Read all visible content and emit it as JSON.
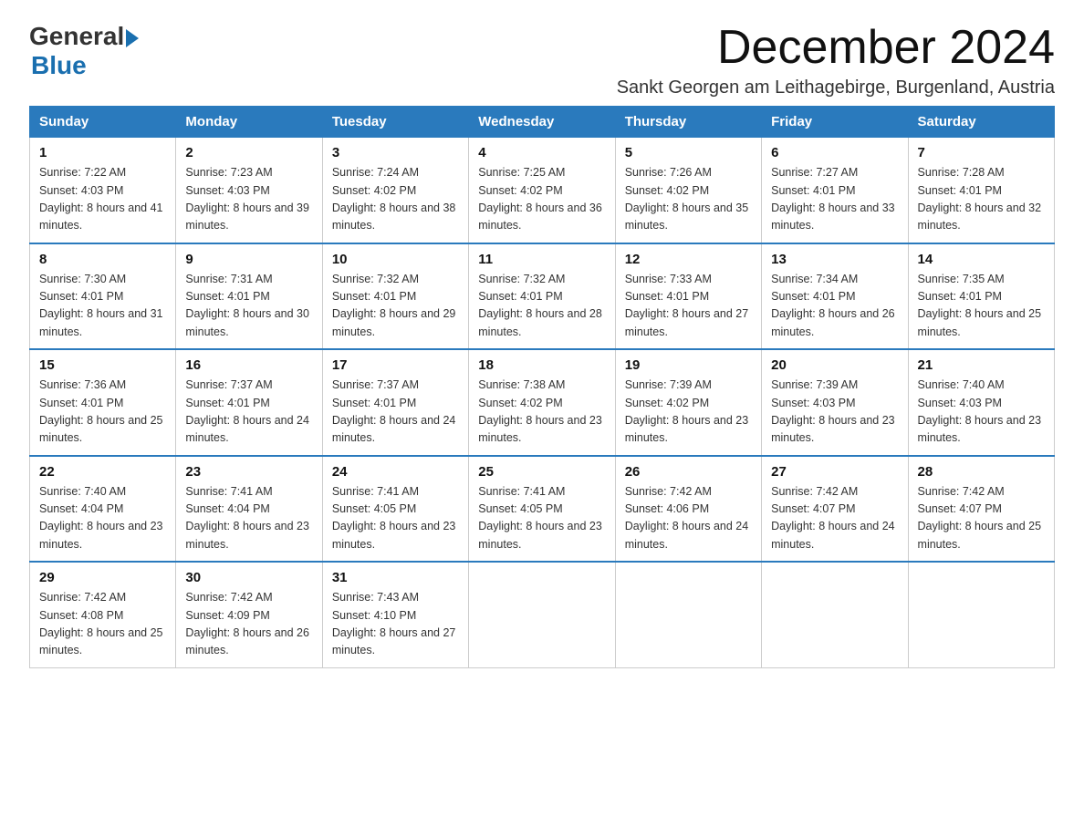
{
  "logo": {
    "general": "General",
    "blue": "Blue",
    "arrow": "▶"
  },
  "title": "December 2024",
  "subtitle": "Sankt Georgen am Leithagebirge, Burgenland, Austria",
  "days_of_week": [
    "Sunday",
    "Monday",
    "Tuesday",
    "Wednesday",
    "Thursday",
    "Friday",
    "Saturday"
  ],
  "weeks": [
    [
      {
        "day": "1",
        "sunrise": "7:22 AM",
        "sunset": "4:03 PM",
        "daylight": "8 hours and 41 minutes."
      },
      {
        "day": "2",
        "sunrise": "7:23 AM",
        "sunset": "4:03 PM",
        "daylight": "8 hours and 39 minutes."
      },
      {
        "day": "3",
        "sunrise": "7:24 AM",
        "sunset": "4:02 PM",
        "daylight": "8 hours and 38 minutes."
      },
      {
        "day": "4",
        "sunrise": "7:25 AM",
        "sunset": "4:02 PM",
        "daylight": "8 hours and 36 minutes."
      },
      {
        "day": "5",
        "sunrise": "7:26 AM",
        "sunset": "4:02 PM",
        "daylight": "8 hours and 35 minutes."
      },
      {
        "day": "6",
        "sunrise": "7:27 AM",
        "sunset": "4:01 PM",
        "daylight": "8 hours and 33 minutes."
      },
      {
        "day": "7",
        "sunrise": "7:28 AM",
        "sunset": "4:01 PM",
        "daylight": "8 hours and 32 minutes."
      }
    ],
    [
      {
        "day": "8",
        "sunrise": "7:30 AM",
        "sunset": "4:01 PM",
        "daylight": "8 hours and 31 minutes."
      },
      {
        "day": "9",
        "sunrise": "7:31 AM",
        "sunset": "4:01 PM",
        "daylight": "8 hours and 30 minutes."
      },
      {
        "day": "10",
        "sunrise": "7:32 AM",
        "sunset": "4:01 PM",
        "daylight": "8 hours and 29 minutes."
      },
      {
        "day": "11",
        "sunrise": "7:32 AM",
        "sunset": "4:01 PM",
        "daylight": "8 hours and 28 minutes."
      },
      {
        "day": "12",
        "sunrise": "7:33 AM",
        "sunset": "4:01 PM",
        "daylight": "8 hours and 27 minutes."
      },
      {
        "day": "13",
        "sunrise": "7:34 AM",
        "sunset": "4:01 PM",
        "daylight": "8 hours and 26 minutes."
      },
      {
        "day": "14",
        "sunrise": "7:35 AM",
        "sunset": "4:01 PM",
        "daylight": "8 hours and 25 minutes."
      }
    ],
    [
      {
        "day": "15",
        "sunrise": "7:36 AM",
        "sunset": "4:01 PM",
        "daylight": "8 hours and 25 minutes."
      },
      {
        "day": "16",
        "sunrise": "7:37 AM",
        "sunset": "4:01 PM",
        "daylight": "8 hours and 24 minutes."
      },
      {
        "day": "17",
        "sunrise": "7:37 AM",
        "sunset": "4:01 PM",
        "daylight": "8 hours and 24 minutes."
      },
      {
        "day": "18",
        "sunrise": "7:38 AM",
        "sunset": "4:02 PM",
        "daylight": "8 hours and 23 minutes."
      },
      {
        "day": "19",
        "sunrise": "7:39 AM",
        "sunset": "4:02 PM",
        "daylight": "8 hours and 23 minutes."
      },
      {
        "day": "20",
        "sunrise": "7:39 AM",
        "sunset": "4:03 PM",
        "daylight": "8 hours and 23 minutes."
      },
      {
        "day": "21",
        "sunrise": "7:40 AM",
        "sunset": "4:03 PM",
        "daylight": "8 hours and 23 minutes."
      }
    ],
    [
      {
        "day": "22",
        "sunrise": "7:40 AM",
        "sunset": "4:04 PM",
        "daylight": "8 hours and 23 minutes."
      },
      {
        "day": "23",
        "sunrise": "7:41 AM",
        "sunset": "4:04 PM",
        "daylight": "8 hours and 23 minutes."
      },
      {
        "day": "24",
        "sunrise": "7:41 AM",
        "sunset": "4:05 PM",
        "daylight": "8 hours and 23 minutes."
      },
      {
        "day": "25",
        "sunrise": "7:41 AM",
        "sunset": "4:05 PM",
        "daylight": "8 hours and 23 minutes."
      },
      {
        "day": "26",
        "sunrise": "7:42 AM",
        "sunset": "4:06 PM",
        "daylight": "8 hours and 24 minutes."
      },
      {
        "day": "27",
        "sunrise": "7:42 AM",
        "sunset": "4:07 PM",
        "daylight": "8 hours and 24 minutes."
      },
      {
        "day": "28",
        "sunrise": "7:42 AM",
        "sunset": "4:07 PM",
        "daylight": "8 hours and 25 minutes."
      }
    ],
    [
      {
        "day": "29",
        "sunrise": "7:42 AM",
        "sunset": "4:08 PM",
        "daylight": "8 hours and 25 minutes."
      },
      {
        "day": "30",
        "sunrise": "7:42 AM",
        "sunset": "4:09 PM",
        "daylight": "8 hours and 26 minutes."
      },
      {
        "day": "31",
        "sunrise": "7:43 AM",
        "sunset": "4:10 PM",
        "daylight": "8 hours and 27 minutes."
      },
      null,
      null,
      null,
      null
    ]
  ],
  "labels": {
    "sunrise_prefix": "Sunrise: ",
    "sunset_prefix": "Sunset: ",
    "daylight_prefix": "Daylight: "
  }
}
